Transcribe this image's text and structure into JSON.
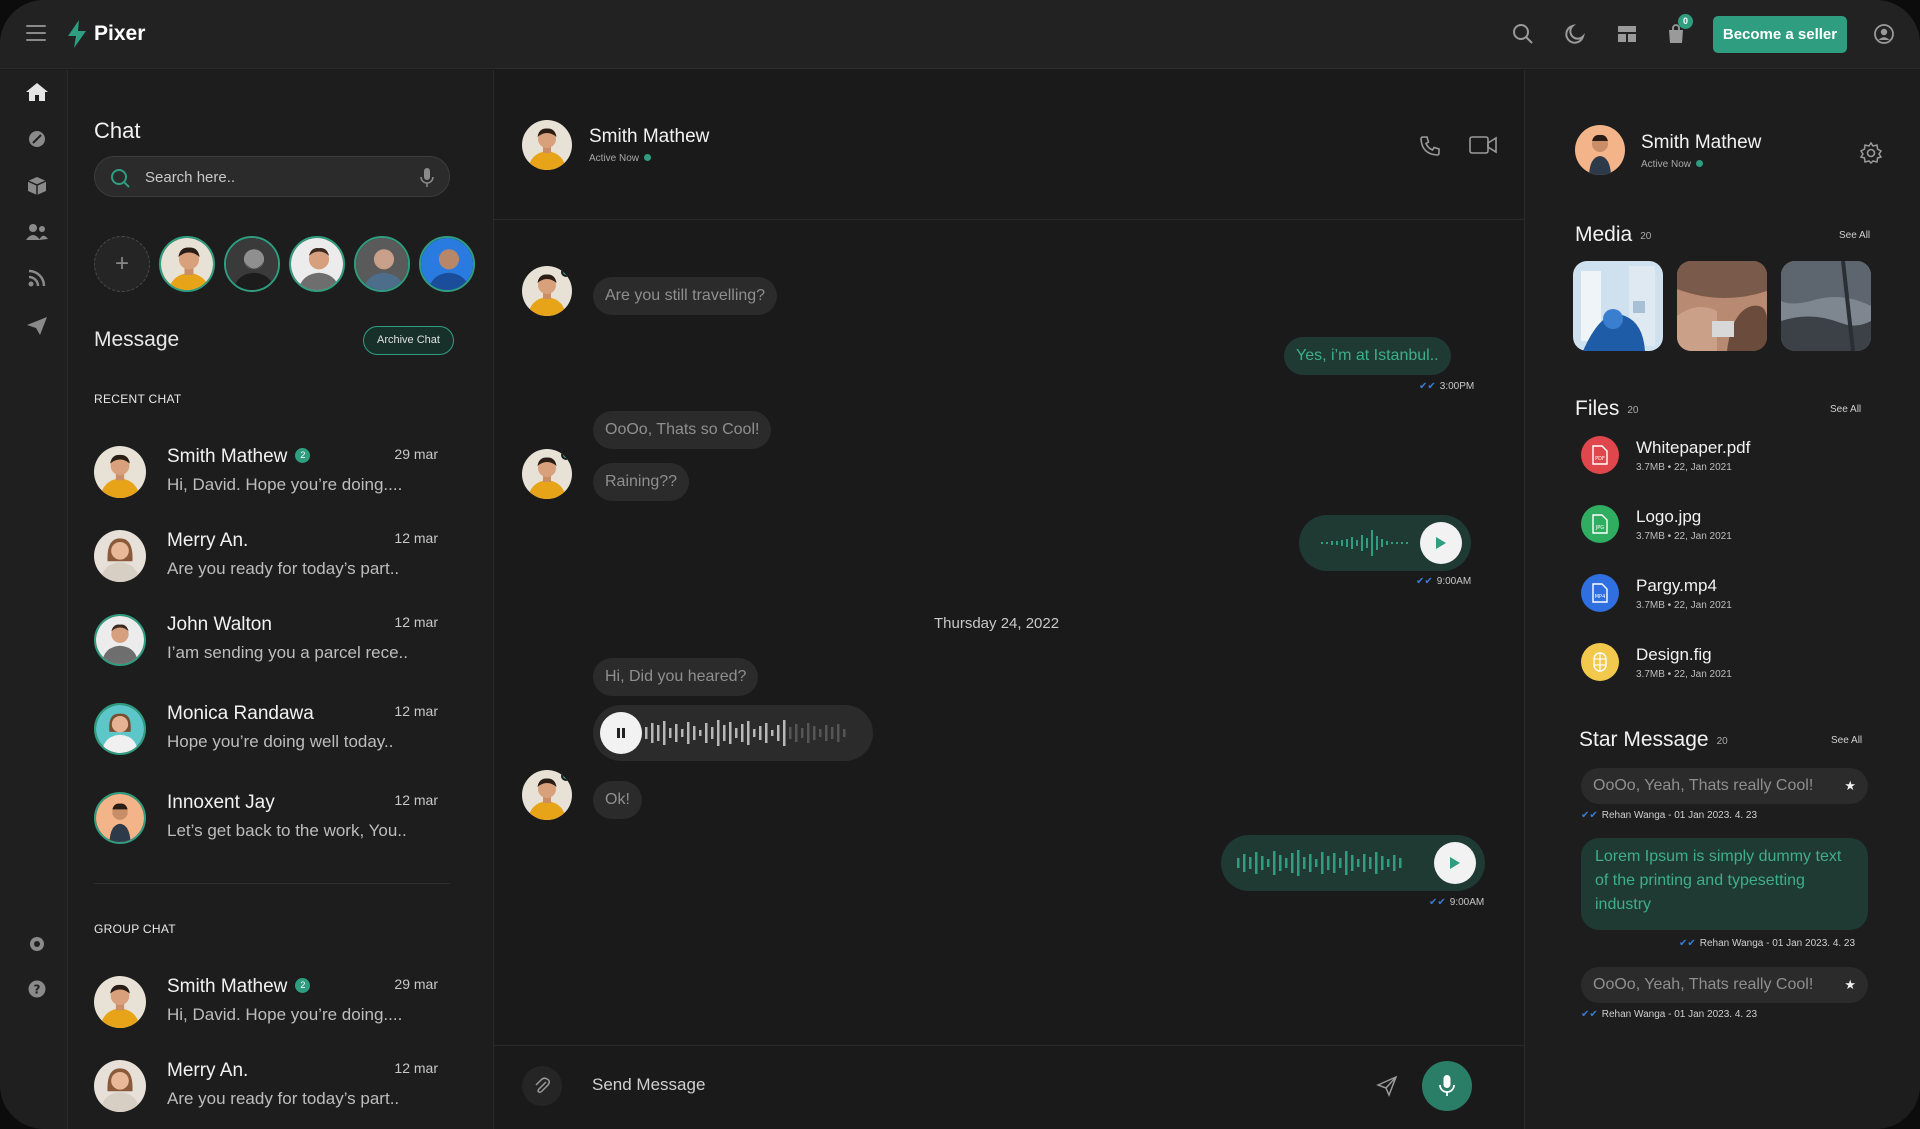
{
  "app": {
    "name": "Pixer",
    "cart_count": "0",
    "seller_label": "Become a seller"
  },
  "chat": {
    "title": "Chat",
    "search_placeholder": "Search here.."
  },
  "messages_panel": {
    "title": "Message",
    "archive_label": "Archive Chat",
    "recent_label": "RECENT CHAT",
    "group_label": "GROUP CHAT"
  },
  "recent": [
    {
      "name": "Smith Mathew",
      "badge": "2",
      "date": "29 mar",
      "preview": "Hi, David. Hope you’re doing...."
    },
    {
      "name": "Merry An.",
      "badge": "",
      "date": "12 mar",
      "preview": "Are you ready for today’s part.."
    },
    {
      "name": "John Walton",
      "badge": "",
      "date": "12 mar",
      "preview": "I’am sending you a parcel rece.."
    },
    {
      "name": "Monica Randawa",
      "badge": "",
      "date": "12 mar",
      "preview": "Hope you’re doing well today.."
    },
    {
      "name": "Innoxent Jay",
      "badge": "",
      "date": "12 mar",
      "preview": "Let’s get back to the work, You.."
    }
  ],
  "groups": [
    {
      "name": "Smith Mathew",
      "badge": "2",
      "date": "29 mar",
      "preview": "Hi, David. Hope you’re doing...."
    },
    {
      "name": "Merry An.",
      "badge": "",
      "date": "12 mar",
      "preview": "Are you ready for today’s part.."
    }
  ],
  "conversation": {
    "name": "Smith Mathew",
    "status": "Active Now",
    "messages": {
      "m1": "Are you still travelling?",
      "m2": "Yes, i’m at Istanbul..",
      "m2_time": "3:00PM",
      "m3": "OoOo, Thats so Cool!",
      "m4": "Raining??",
      "v1_time": "9:00AM",
      "day": "Thursday 24, 2022",
      "m5": "Hi, Did you heared?",
      "m6": "Ok!",
      "v3_time": "9:00AM"
    },
    "composer_placeholder": "Send Message"
  },
  "profile": {
    "name": "Smith Mathew",
    "status": "Active Now"
  },
  "media": {
    "title": "Media",
    "count": "20",
    "see_all": "See All"
  },
  "files": {
    "title": "Files",
    "count": "20",
    "see_all": "See All",
    "items": [
      {
        "name": "Whitepaper.pdf",
        "meta": "3.7MB • 22, Jan 2021",
        "icon": "pdf-file-icon",
        "color": "#e0474c"
      },
      {
        "name": "Logo.jpg",
        "meta": "3.7MB • 22, Jan 2021",
        "icon": "image-file-icon",
        "color": "#2fae62"
      },
      {
        "name": "Pargy.mp4",
        "meta": "3.7MB • 22, Jan 2021",
        "icon": "video-file-icon",
        "color": "#2f6fe0"
      },
      {
        "name": "Design.fig",
        "meta": "3.7MB • 22, Jan 2021",
        "icon": "figma-file-icon",
        "color": "#f2c94c"
      }
    ]
  },
  "stars": {
    "title": "Star Message",
    "count": "20",
    "see_all": "See All",
    "items": [
      {
        "text": "OoOo, Yeah, Thats really Cool!",
        "meta": "Rehan Wanga - 01 Jan 2023. 4. 23"
      },
      {
        "text": "Lorem Ipsum is simply dummy text of the printing and typesetting industry",
        "meta": "Rehan Wanga - 01 Jan 2023. 4. 23"
      },
      {
        "text": "OoOo, Yeah, Thats really Cool!",
        "meta": "Rehan Wanga - 01 Jan 2023. 4. 23"
      }
    ]
  },
  "colors": {
    "accent": "#2f9d7f",
    "background": "#1a1a1a",
    "bubble_in": "#2b2b2b",
    "bubble_out": "#1e3a33"
  }
}
